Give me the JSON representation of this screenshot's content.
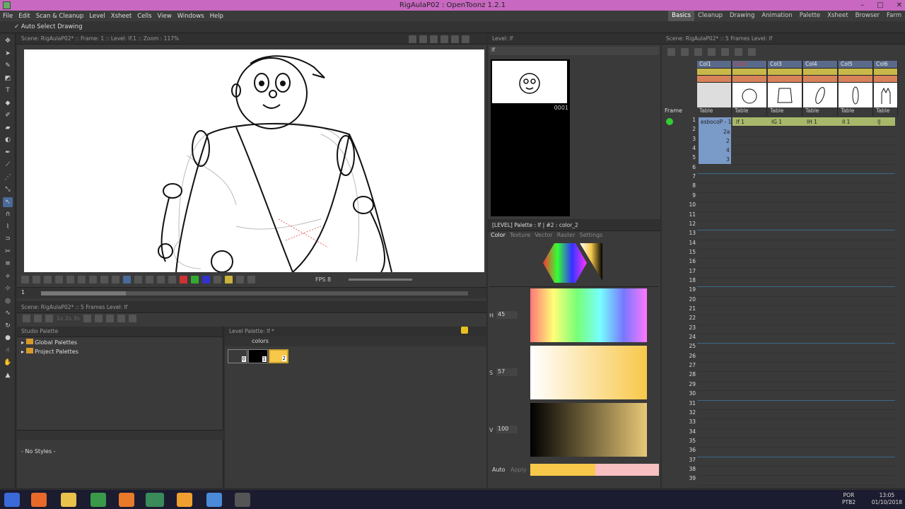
{
  "window": {
    "title": "RigAulaP02 : OpenToonz 1.2.1",
    "controls": [
      "–",
      "□",
      "✕"
    ]
  },
  "menu": [
    "File",
    "Edit",
    "Scan & Cleanup",
    "Level",
    "Xsheet",
    "Cells",
    "View",
    "Windows",
    "Help"
  ],
  "rooms": [
    "Basics",
    "Cleanup",
    "Drawing",
    "Animation",
    "Palette",
    "Xsheet",
    "Browser",
    "Farm"
  ],
  "rooms_active": "Basics",
  "tool_options": {
    "auto_select": "Auto Select Drawing"
  },
  "viewer": {
    "header": "Scene: RigAulaP02*  ::  Frame: 1  ::  Level: lf.1  ::  Zoom : 117%",
    "fps_label": "FPS 8",
    "frame_value": "1"
  },
  "xsheet_bottom": {
    "header": "Scene: RigAulaP02*  ::  5 Frames  Level: lf",
    "frame_toggles": "1s 2s 3s"
  },
  "studio_palette": {
    "title": "Studio Palette",
    "items": [
      "Global Palettes",
      "Project Palettes"
    ],
    "styles": "- No Styles -"
  },
  "level_palette": {
    "title": "Level Palette: lf *",
    "page": "colors",
    "chips": [
      {
        "index": "0",
        "color": "#ffffff"
      },
      {
        "index": "1",
        "color": "#000000"
      },
      {
        "index": "2",
        "color": "#f8c84a"
      }
    ]
  },
  "flipbook": {
    "header": "Level: lf",
    "level_name": "lf",
    "frame": "0001"
  },
  "style_editor": {
    "header": "[LEVEL]  Palette : lf | #2 : color_2",
    "tabs": [
      "Color",
      "Texture",
      "Vector",
      "Raster",
      "Settings"
    ],
    "h_label": "H",
    "h_value": "45",
    "s_label": "S",
    "s_value": "57",
    "v_label": "V",
    "v_value": "100",
    "auto": "Auto",
    "apply": "Apply",
    "current_color": "#f8c84a",
    "old_color": "#f8c0c0"
  },
  "xsheet": {
    "header": "Scene: RigAulaP02*  ::  5 Frames  Level: lf",
    "frame_label": "Frame",
    "columns": [
      {
        "name": "Col1",
        "table": "Table"
      },
      {
        "name": "Col2",
        "table": "Table"
      },
      {
        "name": "Col3",
        "table": "Table"
      },
      {
        "name": "Col4",
        "table": "Table"
      },
      {
        "name": "Col5",
        "table": "Table"
      },
      {
        "name": "Col6",
        "table": "Table"
      }
    ],
    "rows": [
      "1",
      "2",
      "3",
      "4",
      "5",
      "6",
      "7",
      "8",
      "9",
      "10",
      "11",
      "12",
      "13",
      "14",
      "15",
      "16",
      "17",
      "18",
      "19",
      "20",
      "21",
      "22",
      "23",
      "24",
      "25",
      "26",
      "27",
      "28",
      "29",
      "30",
      "31",
      "32",
      "33",
      "34",
      "35",
      "36",
      "37",
      "38",
      "39"
    ],
    "col1_cells": [
      "esbocoP - 1",
      "2a",
      "2",
      "4",
      "3"
    ],
    "row1_cells": [
      "lf  1",
      "lG  1",
      "lH  1",
      "lI  1",
      "lJ"
    ]
  },
  "taskbar": {
    "lang": "POR",
    "layout": "PTB2",
    "time": "13:05",
    "date": "01/10/2018"
  }
}
